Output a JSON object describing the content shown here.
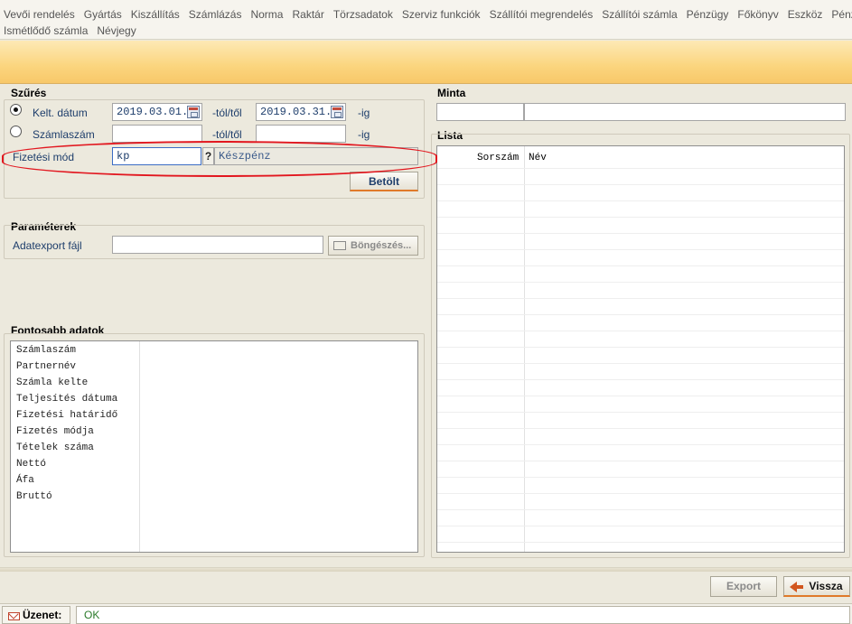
{
  "menu": {
    "row1": [
      "Vevői rendelés",
      "Gyártás",
      "Kiszállítás",
      "Számlázás",
      "Norma",
      "Raktár",
      "Törzsadatok",
      "Szerviz funkciók",
      "Szállítói megrendelés",
      "Szállítói számla",
      "Pénzügy",
      "Főkönyv",
      "Eszköz",
      "Pénztár"
    ],
    "row2": [
      "Ismétlődő számla",
      "Névjegy"
    ]
  },
  "filter": {
    "title": "Szűrés",
    "kelt_datum_label": "Kelt. dátum",
    "date_from": "2019.03.01.",
    "tol_label_1": "-tól/től",
    "date_to": "2019.03.31.",
    "ig_label_1": "-ig",
    "szamlaszam_label": "Számlaszám",
    "szamlaszam_from": "",
    "tol_label_2": "-tól/től",
    "szamlaszam_to": "",
    "ig_label_2": "-ig",
    "fizetesi_mod_label": "Fizetési mód",
    "fizetesi_mod_code": "kp",
    "lookup_label": "?",
    "fizetesi_mod_name": "Készpénz",
    "load_button": "Betölt"
  },
  "params": {
    "title": "Paraméterek",
    "export_file_label": "Adatexport fájl",
    "export_file_value": "",
    "browse_button": "Böngészés..."
  },
  "important": {
    "title": "Fontosabb adatok",
    "fields": [
      "Számlaszám",
      "Partnernév",
      "Számla kelte",
      "Teljesítés dátuma",
      "Fizetési határidő",
      "Fizetés módja",
      "Tételek száma",
      "Nettó",
      "Áfa",
      "Bruttó"
    ]
  },
  "minta": {
    "title": "Minta",
    "field1": "",
    "field2": ""
  },
  "lista": {
    "title": "Lista",
    "col_sorszam": "Sorszám",
    "col_nev": "Név"
  },
  "footer": {
    "export_button": "Export",
    "back_button": "Vissza"
  },
  "status": {
    "label": "Üzenet:",
    "value": "OK"
  },
  "colors": {
    "banner": "#fbd57e",
    "highlight": "#e2171f",
    "accent": "#e07a2a",
    "ok_text": "#2a7a2a"
  }
}
